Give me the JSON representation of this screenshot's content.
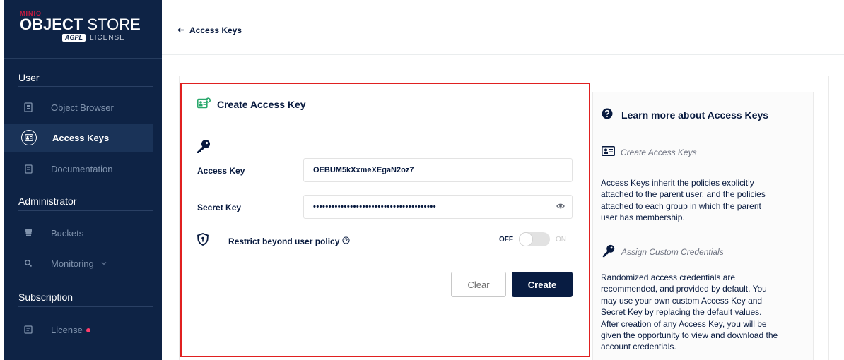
{
  "brand": {
    "vendor": "MINIO",
    "product_bold": "OBJECT",
    "product_light": "STORE",
    "license_badge": "AGPL",
    "license_text": "LICENSE"
  },
  "sidebar": {
    "sections": [
      {
        "label": "User"
      },
      {
        "label": "Administrator"
      },
      {
        "label": "Subscription"
      }
    ],
    "items": [
      {
        "label": "Object Browser",
        "icon": "object-browser-icon",
        "active": false
      },
      {
        "label": "Access Keys",
        "icon": "access-keys-icon",
        "active": true
      },
      {
        "label": "Documentation",
        "icon": "documentation-icon",
        "active": false
      },
      {
        "label": "Buckets",
        "icon": "buckets-icon",
        "active": false
      },
      {
        "label": "Monitoring",
        "icon": "monitoring-icon",
        "active": false
      },
      {
        "label": "License",
        "icon": "license-icon",
        "active": false
      }
    ]
  },
  "header": {
    "back_label": "Access Keys"
  },
  "form": {
    "title": "Create Access Key",
    "access_key_label": "Access Key",
    "access_key_value": "OEBUM5kXxmeXEgaN2oz7",
    "secret_key_label": "Secret Key",
    "secret_key_masked": "••••••••••••••••••••••••••••••••••••••••",
    "restrict_label": "Restrict beyond user policy",
    "toggle_off": "OFF",
    "toggle_on": "ON",
    "toggle_state": false,
    "clear_label": "Clear",
    "create_label": "Create"
  },
  "help": {
    "title": "Learn more about Access Keys",
    "create_heading": "Create Access Keys",
    "create_lines": [
      "Access Keys inherit the policies explicitly",
      "attached to the parent user, and the policies",
      "attached to each group in which the parent",
      "user has membership."
    ],
    "custom_heading": "Assign Custom Credentials",
    "custom_lines": [
      "Randomized access credentials are",
      "recommended, and provided by default. You",
      "may use your own custom Access Key and",
      "Secret Key by replacing the default values.",
      "After creation of any Access Key, you will be",
      "given the opportunity to view and download the",
      "account credentials."
    ]
  },
  "colors": {
    "sidebar_bg": "#0e2345",
    "primary": "#081c42",
    "highlight_border": "#e02020",
    "accent_green": "#2aa86c",
    "notification_dot": "#ff3d6b"
  }
}
